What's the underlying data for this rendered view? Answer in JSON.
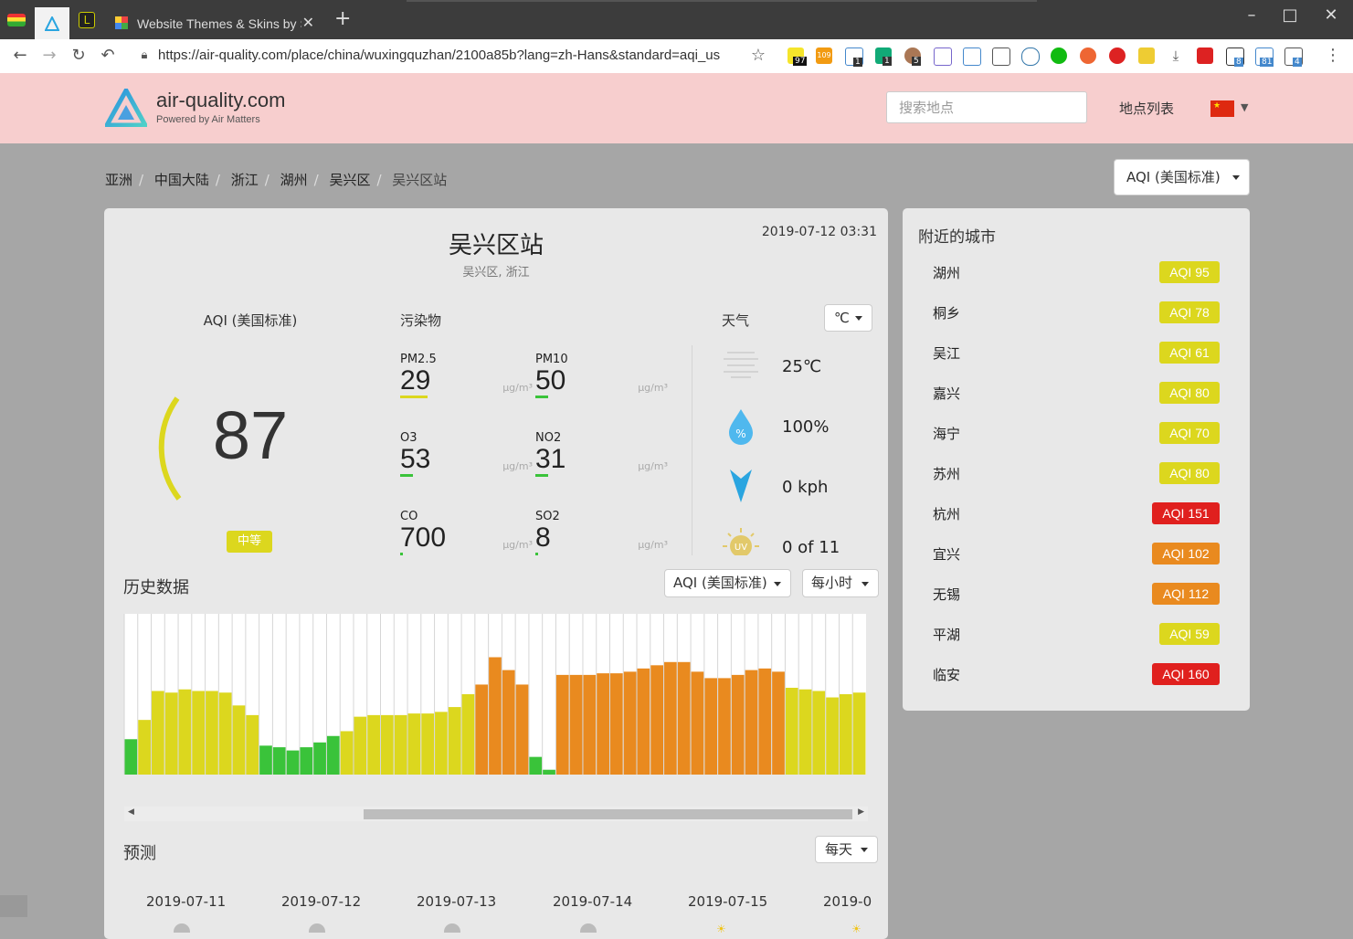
{
  "browser": {
    "tab_title": "Website Themes & Skins by St",
    "url": "https://air-quality.com/place/china/wuxingquzhan/2100a85b?lang=zh-Hans&standard=aqi_us",
    "ext_badges": [
      "97",
      "109",
      "1",
      "1",
      "5",
      "8",
      "81",
      "4"
    ]
  },
  "header": {
    "site_name": "air-quality.com",
    "site_tagline": "Powered by Air Matters",
    "search_placeholder": "搜索地点",
    "location_list": "地点列表"
  },
  "breadcrumb": [
    "亚洲",
    "中国大陆",
    "浙江",
    "湖州",
    "吴兴区",
    "吴兴区站"
  ],
  "standard_dropdown": "AQI (美国标准)",
  "station": {
    "name": "吴兴区站",
    "region": "吴兴区, 浙江",
    "timestamp": "2019-07-12 03:31"
  },
  "aqi": {
    "label": "AQI (美国标准)",
    "value": "87",
    "level": "中等",
    "level_color": "#dcd71e"
  },
  "pollutants": {
    "label": "污染物",
    "items": [
      {
        "name": "PM2.5",
        "value": "29",
        "unit": "μg/m³",
        "color": "#dcd71e"
      },
      {
        "name": "PM10",
        "value": "50",
        "unit": "μg/m³",
        "color": "#3ac33a"
      },
      {
        "name": "O3",
        "value": "53",
        "unit": "μg/m³",
        "color": "#3ac33a"
      },
      {
        "name": "NO2",
        "value": "31",
        "unit": "μg/m³",
        "color": "#3ac33a"
      },
      {
        "name": "CO",
        "value": "700",
        "unit": "μg/m³",
        "color": "#3ac33a"
      },
      {
        "name": "SO2",
        "value": "8",
        "unit": "μg/m³",
        "color": "#3ac33a"
      }
    ]
  },
  "weather": {
    "label": "天气",
    "unit_select": "℃",
    "temperature": "25℃",
    "humidity": "100%",
    "wind": "0 kph",
    "uv": "0 of 11"
  },
  "history": {
    "title": "历史数据",
    "standard_select": "AQI (美国标准)",
    "interval_select": "每小时"
  },
  "chart_data": {
    "type": "bar",
    "values": [
      22,
      34,
      52,
      51,
      53,
      52,
      52,
      51,
      43,
      37,
      18,
      17,
      15,
      17,
      20,
      24,
      27,
      36,
      37,
      37,
      37,
      38,
      38,
      39,
      42,
      50,
      56,
      73,
      65,
      56,
      11,
      3,
      62,
      62,
      62,
      63,
      63,
      64,
      66,
      68,
      70,
      70,
      64,
      60,
      60,
      62,
      65,
      66,
      64,
      54,
      53,
      52,
      48,
      50,
      51
    ],
    "colors": {
      "good": "#3ac33a",
      "moderate": "#dcd71e",
      "sensitive": "#e98a1f"
    }
  },
  "forecast": {
    "title": "预测",
    "interval_select": "每天",
    "dates": [
      "2019-07-11",
      "2019-07-12",
      "2019-07-13",
      "2019-07-14",
      "2019-07-15",
      "2019-0"
    ]
  },
  "nearby": {
    "title": "附近的城市",
    "cities": [
      {
        "name": "湖州",
        "aqi": "AQI 95",
        "color": "#dcd71e"
      },
      {
        "name": "桐乡",
        "aqi": "AQI 78",
        "color": "#dcd71e"
      },
      {
        "name": "吴江",
        "aqi": "AQI 61",
        "color": "#dcd71e"
      },
      {
        "name": "嘉兴",
        "aqi": "AQI 80",
        "color": "#dcd71e"
      },
      {
        "name": "海宁",
        "aqi": "AQI 70",
        "color": "#dcd71e"
      },
      {
        "name": "苏州",
        "aqi": "AQI 80",
        "color": "#dcd71e"
      },
      {
        "name": "杭州",
        "aqi": "AQI 151",
        "color": "#e0201e"
      },
      {
        "name": "宜兴",
        "aqi": "AQI 102",
        "color": "#e98a1f"
      },
      {
        "name": "无锡",
        "aqi": "AQI 112",
        "color": "#e98a1f"
      },
      {
        "name": "平湖",
        "aqi": "AQI 59",
        "color": "#dcd71e"
      },
      {
        "name": "临安",
        "aqi": "AQI 160",
        "color": "#e0201e"
      }
    ]
  }
}
